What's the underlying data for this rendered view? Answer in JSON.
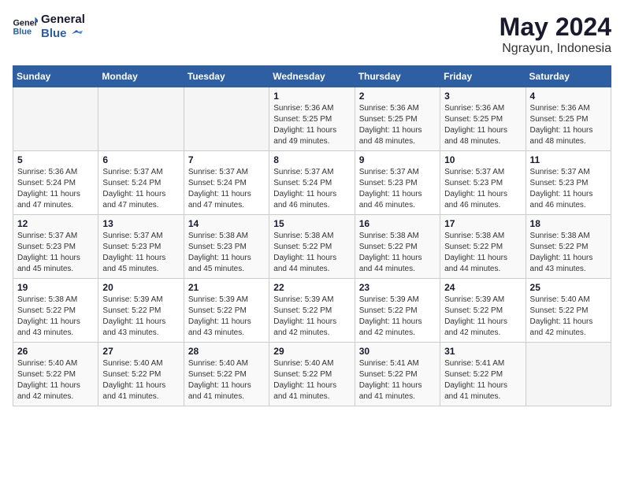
{
  "header": {
    "logo_line1": "General",
    "logo_line2": "Blue",
    "month_year": "May 2024",
    "location": "Ngrayun, Indonesia"
  },
  "weekdays": [
    "Sunday",
    "Monday",
    "Tuesday",
    "Wednesday",
    "Thursday",
    "Friday",
    "Saturday"
  ],
  "weeks": [
    [
      {
        "day": "",
        "info": ""
      },
      {
        "day": "",
        "info": ""
      },
      {
        "day": "",
        "info": ""
      },
      {
        "day": "1",
        "info": "Sunrise: 5:36 AM\nSunset: 5:25 PM\nDaylight: 11 hours\nand 49 minutes."
      },
      {
        "day": "2",
        "info": "Sunrise: 5:36 AM\nSunset: 5:25 PM\nDaylight: 11 hours\nand 48 minutes."
      },
      {
        "day": "3",
        "info": "Sunrise: 5:36 AM\nSunset: 5:25 PM\nDaylight: 11 hours\nand 48 minutes."
      },
      {
        "day": "4",
        "info": "Sunrise: 5:36 AM\nSunset: 5:25 PM\nDaylight: 11 hours\nand 48 minutes."
      }
    ],
    [
      {
        "day": "5",
        "info": "Sunrise: 5:36 AM\nSunset: 5:24 PM\nDaylight: 11 hours\nand 47 minutes."
      },
      {
        "day": "6",
        "info": "Sunrise: 5:37 AM\nSunset: 5:24 PM\nDaylight: 11 hours\nand 47 minutes."
      },
      {
        "day": "7",
        "info": "Sunrise: 5:37 AM\nSunset: 5:24 PM\nDaylight: 11 hours\nand 47 minutes."
      },
      {
        "day": "8",
        "info": "Sunrise: 5:37 AM\nSunset: 5:24 PM\nDaylight: 11 hours\nand 46 minutes."
      },
      {
        "day": "9",
        "info": "Sunrise: 5:37 AM\nSunset: 5:23 PM\nDaylight: 11 hours\nand 46 minutes."
      },
      {
        "day": "10",
        "info": "Sunrise: 5:37 AM\nSunset: 5:23 PM\nDaylight: 11 hours\nand 46 minutes."
      },
      {
        "day": "11",
        "info": "Sunrise: 5:37 AM\nSunset: 5:23 PM\nDaylight: 11 hours\nand 46 minutes."
      }
    ],
    [
      {
        "day": "12",
        "info": "Sunrise: 5:37 AM\nSunset: 5:23 PM\nDaylight: 11 hours\nand 45 minutes."
      },
      {
        "day": "13",
        "info": "Sunrise: 5:37 AM\nSunset: 5:23 PM\nDaylight: 11 hours\nand 45 minutes."
      },
      {
        "day": "14",
        "info": "Sunrise: 5:38 AM\nSunset: 5:23 PM\nDaylight: 11 hours\nand 45 minutes."
      },
      {
        "day": "15",
        "info": "Sunrise: 5:38 AM\nSunset: 5:22 PM\nDaylight: 11 hours\nand 44 minutes."
      },
      {
        "day": "16",
        "info": "Sunrise: 5:38 AM\nSunset: 5:22 PM\nDaylight: 11 hours\nand 44 minutes."
      },
      {
        "day": "17",
        "info": "Sunrise: 5:38 AM\nSunset: 5:22 PM\nDaylight: 11 hours\nand 44 minutes."
      },
      {
        "day": "18",
        "info": "Sunrise: 5:38 AM\nSunset: 5:22 PM\nDaylight: 11 hours\nand 43 minutes."
      }
    ],
    [
      {
        "day": "19",
        "info": "Sunrise: 5:38 AM\nSunset: 5:22 PM\nDaylight: 11 hours\nand 43 minutes."
      },
      {
        "day": "20",
        "info": "Sunrise: 5:39 AM\nSunset: 5:22 PM\nDaylight: 11 hours\nand 43 minutes."
      },
      {
        "day": "21",
        "info": "Sunrise: 5:39 AM\nSunset: 5:22 PM\nDaylight: 11 hours\nand 43 minutes."
      },
      {
        "day": "22",
        "info": "Sunrise: 5:39 AM\nSunset: 5:22 PM\nDaylight: 11 hours\nand 42 minutes."
      },
      {
        "day": "23",
        "info": "Sunrise: 5:39 AM\nSunset: 5:22 PM\nDaylight: 11 hours\nand 42 minutes."
      },
      {
        "day": "24",
        "info": "Sunrise: 5:39 AM\nSunset: 5:22 PM\nDaylight: 11 hours\nand 42 minutes."
      },
      {
        "day": "25",
        "info": "Sunrise: 5:40 AM\nSunset: 5:22 PM\nDaylight: 11 hours\nand 42 minutes."
      }
    ],
    [
      {
        "day": "26",
        "info": "Sunrise: 5:40 AM\nSunset: 5:22 PM\nDaylight: 11 hours\nand 42 minutes."
      },
      {
        "day": "27",
        "info": "Sunrise: 5:40 AM\nSunset: 5:22 PM\nDaylight: 11 hours\nand 41 minutes."
      },
      {
        "day": "28",
        "info": "Sunrise: 5:40 AM\nSunset: 5:22 PM\nDaylight: 11 hours\nand 41 minutes."
      },
      {
        "day": "29",
        "info": "Sunrise: 5:40 AM\nSunset: 5:22 PM\nDaylight: 11 hours\nand 41 minutes."
      },
      {
        "day": "30",
        "info": "Sunrise: 5:41 AM\nSunset: 5:22 PM\nDaylight: 11 hours\nand 41 minutes."
      },
      {
        "day": "31",
        "info": "Sunrise: 5:41 AM\nSunset: 5:22 PM\nDaylight: 11 hours\nand 41 minutes."
      },
      {
        "day": "",
        "info": ""
      }
    ]
  ]
}
